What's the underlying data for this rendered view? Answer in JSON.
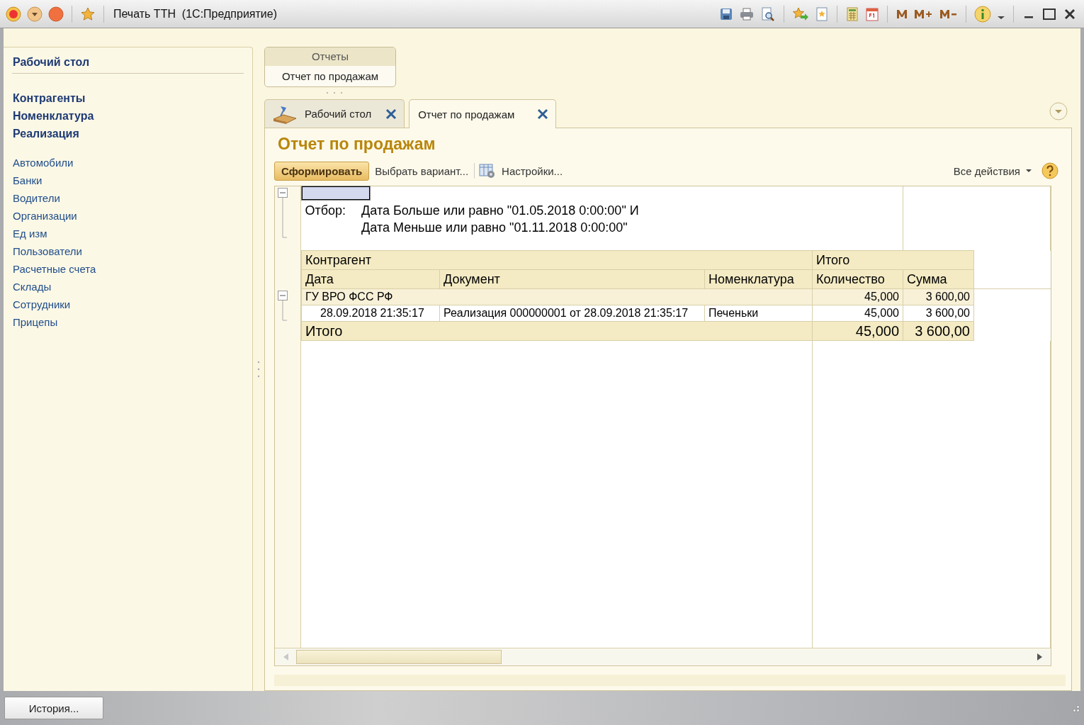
{
  "window": {
    "title": "Печать ТТН  (1С:Предприятие)"
  },
  "sidebar": {
    "title": "Рабочий стол",
    "main_items": [
      {
        "label": "Контрагенты"
      },
      {
        "label": "Номенклатура"
      },
      {
        "label": "Реализация"
      }
    ],
    "items": [
      {
        "label": "Автомобили"
      },
      {
        "label": "Банки"
      },
      {
        "label": "Водители"
      },
      {
        "label": "Организации"
      },
      {
        "label": "Ед изм"
      },
      {
        "label": "Пользователи"
      },
      {
        "label": "Расчетные счета"
      },
      {
        "label": "Склады"
      },
      {
        "label": "Сотрудники"
      },
      {
        "label": "Прицепы"
      }
    ]
  },
  "section_group": {
    "title": "Отчеты",
    "items": [
      {
        "label": "Отчет по продажам"
      }
    ]
  },
  "tabs": [
    {
      "label": "Рабочий стол",
      "kind": "desktop",
      "selected": false
    },
    {
      "label": "Отчет по продажам",
      "kind": "plain",
      "selected": true
    }
  ],
  "page_title": "Отчет по продажам",
  "toolbar": {
    "generate": "Сформировать",
    "choose_variant": "Выбрать вариант...",
    "settings": "Настройки...",
    "all_actions": "Все действия"
  },
  "report": {
    "filter_expanded": true,
    "filter_label": "Отбор:",
    "filter_lines": [
      "Дата Больше или равно \"01.05.2018 0:00:00\" И",
      "Дата Меньше или равно \"01.11.2018 0:00:00\""
    ],
    "group_header": "Контрагент",
    "totals_header": "Итого",
    "columns": [
      "Дата",
      "Документ",
      "Номенклатура",
      "Количество",
      "Сумма"
    ],
    "rows": [
      {
        "kind": "group",
        "expanded": true,
        "label": "ГУ ВРО ФСС РФ",
        "quantity": "45,000",
        "sum": "3 600,00"
      },
      {
        "kind": "detail",
        "date": "28.09.2018 21:35:17",
        "document": "Реализация 000000001 от 28.09.2018 21:35:17",
        "item": "Печеньки",
        "quantity": "45,000",
        "sum": "3 600,00"
      },
      {
        "kind": "total",
        "label": "Итого",
        "quantity": "45,000",
        "sum": "3 600,00"
      }
    ]
  },
  "history_button": "История..."
}
